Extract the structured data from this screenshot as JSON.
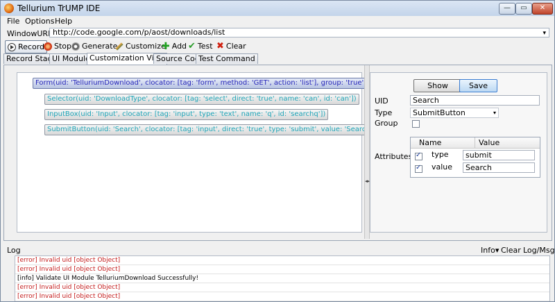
{
  "window": {
    "title": "Tellurium TrUMP IDE",
    "min_label": "—",
    "max_label": "▭",
    "close_label": "✕"
  },
  "menu": {
    "file": "File",
    "options": "Options",
    "help": "Help"
  },
  "url": {
    "label": "WindowURL",
    "value": "http://code.google.com/p/aost/downloads/list",
    "dropdown": "▾"
  },
  "toolbar": {
    "record": "Record",
    "stop": "Stop",
    "generate": "Generate",
    "customize": "Customize",
    "add": "Add",
    "test": "Test",
    "clear": "Clear",
    "add_glyph": "✚",
    "test_glyph": "✔",
    "clear_glyph": "✖"
  },
  "tabs": [
    "Record Stack",
    "UI Module",
    "Customization View",
    "Source Code",
    "Test Command"
  ],
  "active_tab": "Customization View",
  "tree": {
    "form": "Form(uid: 'TelluriumDownload', clocator: [tag: 'form', method: 'GET', action: 'list'], group: 'true')",
    "children": [
      "Selector(uid: 'DownloadType', clocator: [tag: 'select', direct: 'true', name: 'can', id: 'can'])",
      "InputBox(uid: 'Input', clocator: [tag: 'input', type: 'text', name: 'q', id: 'searchq'])",
      "SubmitButton(uid: 'Search', clocator: [tag: 'input', direct: 'true', type: 'submit', value: 'Search'])"
    ]
  },
  "splitter_arrow": "◂▸",
  "props": {
    "show": "Show",
    "save": "Save",
    "uid_label": "UID",
    "uid_value": "Search",
    "type_label": "Type",
    "type_value": "SubmitButton",
    "type_arrow": "▾",
    "group_label": "Group",
    "attributes_label": "Attributes",
    "col_name": "Name",
    "col_value": "Value",
    "attributes": [
      {
        "name": "type",
        "value": "submit",
        "checked": true
      },
      {
        "name": "value",
        "value": "Search",
        "checked": true
      }
    ]
  },
  "log": {
    "title": "Log",
    "info_menu": "Info▾",
    "clear": "Clear",
    "logmsg": "Log/Msg",
    "lines": [
      {
        "level": "error",
        "text": "[error] Invalid uid [object Object]"
      },
      {
        "level": "error",
        "text": "[error] Invalid uid [object Object]"
      },
      {
        "level": "info",
        "text": "[info] Validate UI Module TelluriumDownload Successfully!"
      },
      {
        "level": "error",
        "text": "[error] Invalid uid [object Object]"
      },
      {
        "level": "error",
        "text": "[error] Invalid uid [object Object]"
      }
    ]
  }
}
